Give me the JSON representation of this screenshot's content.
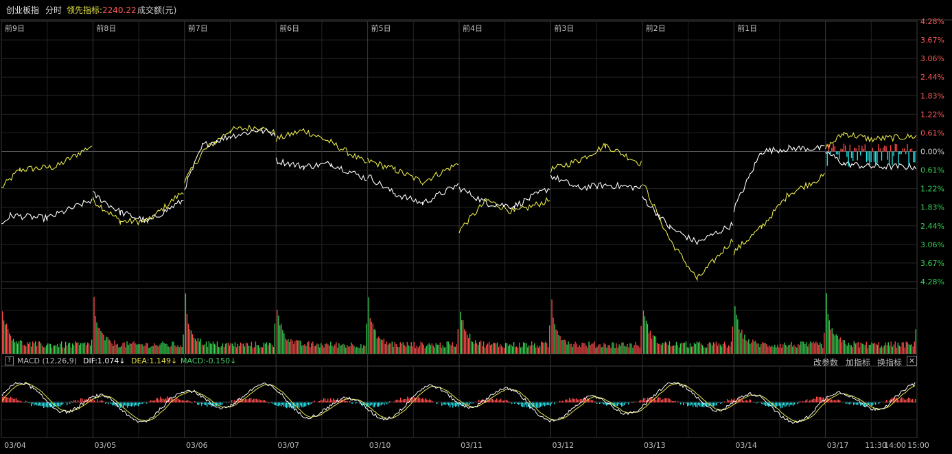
{
  "header": {
    "title": "创业板指",
    "mode": "分时",
    "leader_label": "领先指标:",
    "leader_value": "2240.22",
    "volume_label": "成交额(元)"
  },
  "colors": {
    "background": "#000000",
    "grid": "#262626",
    "up": "#ff4b4b",
    "down": "#37d552",
    "price_line": "#ffffff",
    "leader_line": "#e8e84a",
    "macd_neg": "#27e0e6",
    "dif": "#ffffff",
    "dea": "#e8e84a",
    "macd_label": "#4ad36a"
  },
  "day_labels": [
    "前9日",
    "前8日",
    "前7日",
    "前6日",
    "前5日",
    "前4日",
    "前3日",
    "前2日",
    "前1日"
  ],
  "right_axis": [
    "4.28%",
    "3.67%",
    "3.06%",
    "2.44%",
    "1.83%",
    "1.22%",
    "0.61%",
    "0.00%",
    "0.61%",
    "1.22%",
    "1.83%",
    "2.44%",
    "3.06%",
    "3.67%",
    "4.28%"
  ],
  "macd": {
    "help": "?",
    "name": "MACD (12,26,9)",
    "dif": "DIF:1.074",
    "dea": "DEA:1.149",
    "macd": "MACD:-0.150",
    "arrow": "↓",
    "buttons": [
      "改参数",
      "加指标",
      "换指标"
    ],
    "close": "✕"
  },
  "x_axis": [
    "03/04",
    "03/05",
    "03/06",
    "03/07",
    "03/10",
    "03/11",
    "03/12",
    "03/13",
    "03/14",
    "03/17",
    "11:30",
    "14:00",
    "15:00"
  ],
  "chart_data": {
    "type": "line",
    "days": [
      "03/04",
      "03/05",
      "03/06",
      "03/07",
      "03/10",
      "03/11",
      "03/12",
      "03/13",
      "03/14",
      "03/17"
    ],
    "y_unit": "%",
    "ylim": [
      -4.28,
      4.28
    ],
    "series": [
      {
        "name": "创业板指",
        "points": [
          [
            0,
            -2.4
          ],
          [
            0.1,
            -2.1
          ],
          [
            0.5,
            -2.2
          ],
          [
            0.99,
            -1.6
          ],
          [
            1.0,
            -1.4
          ],
          [
            1.3,
            -2.0
          ],
          [
            1.6,
            -2.3
          ],
          [
            1.99,
            -1.6
          ],
          [
            2.0,
            -1.2
          ],
          [
            2.2,
            0.2
          ],
          [
            2.5,
            0.5
          ],
          [
            2.8,
            0.7
          ],
          [
            2.99,
            0.6
          ],
          [
            3.0,
            -0.3
          ],
          [
            3.3,
            -0.5
          ],
          [
            3.6,
            -0.4
          ],
          [
            3.99,
            -0.9
          ],
          [
            4.0,
            -0.8
          ],
          [
            4.3,
            -1.4
          ],
          [
            4.6,
            -1.7
          ],
          [
            4.99,
            -1.1
          ],
          [
            5.0,
            -1.2
          ],
          [
            5.3,
            -1.7
          ],
          [
            5.6,
            -1.8
          ],
          [
            5.99,
            -1.2
          ],
          [
            6.0,
            -0.8
          ],
          [
            6.3,
            -1.2
          ],
          [
            6.6,
            -1.1
          ],
          [
            6.99,
            -1.2
          ],
          [
            7.0,
            -1.5
          ],
          [
            7.3,
            -2.5
          ],
          [
            7.6,
            -3.0
          ],
          [
            7.99,
            -2.4
          ],
          [
            8.0,
            -1.9
          ],
          [
            8.3,
            0.0
          ],
          [
            8.6,
            0.1
          ],
          [
            8.99,
            0.1
          ],
          [
            9.0,
            0.0
          ],
          [
            9.2,
            -0.4
          ],
          [
            9.5,
            -0.5
          ],
          [
            9.99,
            -0.5
          ]
        ]
      },
      {
        "name": "领先指标",
        "points": [
          [
            0,
            -1.2
          ],
          [
            0.2,
            -0.6
          ],
          [
            0.6,
            -0.5
          ],
          [
            0.99,
            0.2
          ],
          [
            1.0,
            -1.6
          ],
          [
            1.3,
            -2.3
          ],
          [
            1.6,
            -2.3
          ],
          [
            1.99,
            -1.3
          ],
          [
            2.0,
            -1.0
          ],
          [
            2.2,
            0.0
          ],
          [
            2.5,
            0.7
          ],
          [
            2.8,
            0.8
          ],
          [
            2.99,
            0.6
          ],
          [
            3.0,
            0.4
          ],
          [
            3.3,
            0.7
          ],
          [
            3.6,
            0.3
          ],
          [
            3.99,
            -0.4
          ],
          [
            4.0,
            -0.3
          ],
          [
            4.3,
            -0.6
          ],
          [
            4.6,
            -1.0
          ],
          [
            4.99,
            -0.4
          ],
          [
            5.0,
            -2.6
          ],
          [
            5.3,
            -1.6
          ],
          [
            5.6,
            -2.0
          ],
          [
            5.99,
            -1.6
          ],
          [
            6.0,
            -0.6
          ],
          [
            6.3,
            -0.3
          ],
          [
            6.6,
            0.2
          ],
          [
            6.99,
            -0.4
          ],
          [
            7.0,
            -1.0
          ],
          [
            7.3,
            -2.9
          ],
          [
            7.6,
            -4.2
          ],
          [
            7.99,
            -2.9
          ],
          [
            8.0,
            -3.3
          ],
          [
            8.3,
            -2.5
          ],
          [
            8.6,
            -1.4
          ],
          [
            8.99,
            -0.8
          ],
          [
            9.0,
            0.1
          ],
          [
            9.2,
            0.6
          ],
          [
            9.5,
            0.4
          ],
          [
            9.99,
            0.5
          ]
        ]
      }
    ]
  }
}
